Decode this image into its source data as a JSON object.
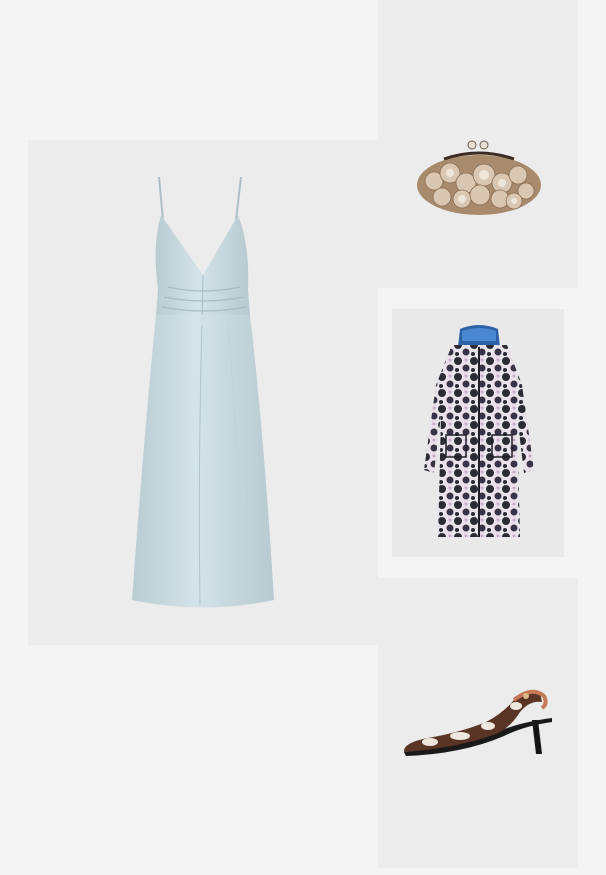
{
  "page": {
    "background": "#f4f4f4",
    "panel_color": "#ececec"
  },
  "products": [
    {
      "id": "dress",
      "icon": "slip-dress-image",
      "color": "#c9dadf"
    },
    {
      "id": "clutch",
      "icon": "fur-clutch-image",
      "color": "#b89a7c"
    },
    {
      "id": "coat",
      "icon": "printed-coat-image",
      "color": "#2c2c3c"
    },
    {
      "id": "shoe",
      "icon": "slingback-pump-image",
      "color": "#5a3a2a"
    }
  ]
}
